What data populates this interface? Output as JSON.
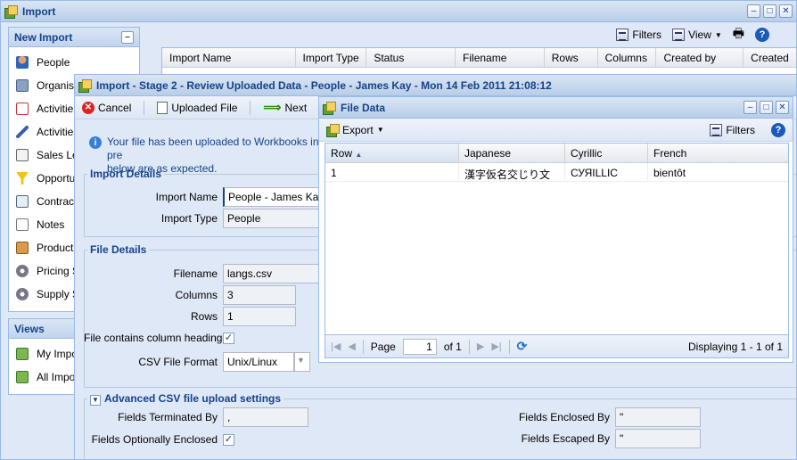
{
  "main_window": {
    "title": "Import",
    "new_import_panel": {
      "title": "New Import",
      "items": [
        {
          "label": "People",
          "icon": "person-icon"
        },
        {
          "label": "Organisations",
          "icon": "building-icon"
        },
        {
          "label": "Activities",
          "icon": "checklist-icon"
        },
        {
          "label": "Activities",
          "icon": "pen-icon"
        },
        {
          "label": "Sales Leads",
          "icon": "card-icon"
        },
        {
          "label": "Opportunities",
          "icon": "funnel-icon"
        },
        {
          "label": "Contracts",
          "icon": "contract-icon"
        },
        {
          "label": "Notes",
          "icon": "notes-icon"
        },
        {
          "label": "Products",
          "icon": "box-icon"
        },
        {
          "label": "Pricing Schedules",
          "icon": "gear-icon"
        },
        {
          "label": "Supply Sources",
          "icon": "gear-icon"
        }
      ]
    },
    "views_panel": {
      "title": "Views",
      "items": [
        {
          "label": "My Imports",
          "icon": "view-icon"
        },
        {
          "label": "All Imports",
          "icon": "view-icon"
        }
      ]
    },
    "toolbar": {
      "filters": "Filters",
      "view": "View"
    },
    "grid_columns": [
      "Import Name",
      "Import Type",
      "Status",
      "Filename",
      "Rows",
      "Columns",
      "Created by",
      "Created"
    ]
  },
  "stage_window": {
    "title": "Import - Stage 2 - Review Uploaded Data - People - James Kay - Mon 14 Feb 2011 21:08:12",
    "toolbar": {
      "cancel": "Cancel",
      "uploaded_file": "Uploaded File",
      "next": "Next"
    },
    "info_text_1": "Your file has been uploaded to Workbooks in pre",
    "info_text_2": "below are as expected.",
    "import_details": {
      "legend": "Import Details",
      "import_name_label": "Import Name",
      "import_name_value": "People - James Kay",
      "import_type_label": "Import Type",
      "import_type_value": "People"
    },
    "file_details": {
      "legend": "File Details",
      "filename_label": "Filename",
      "filename_value": "langs.csv",
      "columns_label": "Columns",
      "columns_value": "3",
      "rows_label": "Rows",
      "rows_value": "1",
      "headings_label": "File contains column headings",
      "csv_format_label": "CSV File Format",
      "csv_format_value": "Unix/Linux"
    },
    "advanced": {
      "legend": "Advanced CSV file upload settings",
      "terminated_label": "Fields Terminated By",
      "terminated_value": ",",
      "optionally_label": "Fields Optionally Enclosed",
      "enclosed_label": "Fields Enclosed By",
      "enclosed_value": "\"",
      "escaped_label": "Fields Escaped By",
      "escaped_value": "\""
    }
  },
  "file_window": {
    "title": "File Data",
    "export": "Export",
    "filters": "Filters",
    "columns": [
      "Row",
      "Japanese",
      "Cyrillic",
      "French"
    ],
    "rows": [
      {
        "row": "1",
        "japanese": "漢字仮名交じり文",
        "cyrillic": "СУЯILLIC",
        "french": "bientôt"
      }
    ],
    "pager": {
      "page_label": "Page",
      "page_value": "1",
      "of_label": "of 1",
      "displaying": "Displaying 1 - 1 of 1"
    }
  }
}
